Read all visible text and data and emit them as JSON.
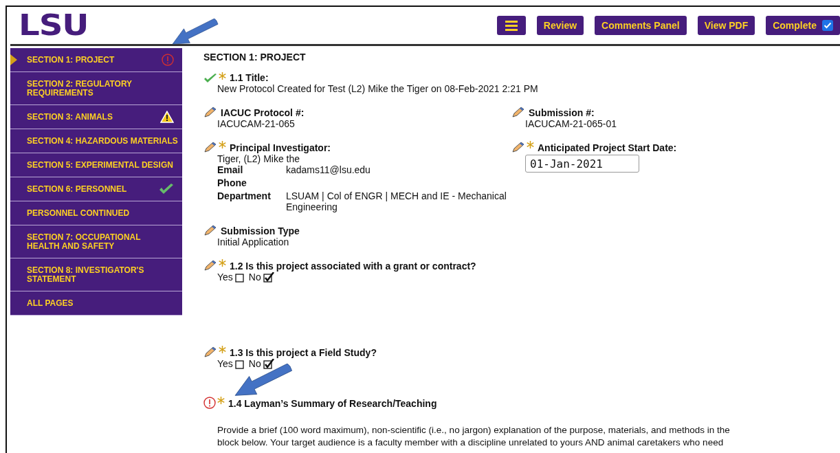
{
  "header": {
    "logo": "LSU",
    "menu_button": {
      "kind": "menu"
    },
    "buttons": [
      {
        "label": "Review",
        "kind": "plain"
      },
      {
        "label": "Comments Panel",
        "kind": "plain"
      },
      {
        "label": "View PDF",
        "kind": "plain"
      },
      {
        "label": "Complete",
        "kind": "checkbox",
        "checked": true
      }
    ]
  },
  "sidebar": {
    "items": [
      {
        "label": "SECTION 1: PROJECT",
        "selected": true,
        "kind": "error",
        "annotated": true
      },
      {
        "label": "SECTION 2: REGULATORY REQUIREMENTS",
        "selected": false,
        "kind": "plain",
        "annotated": false
      },
      {
        "label": "SECTION 3: ANIMALS",
        "selected": false,
        "kind": "warning",
        "annotated": false
      },
      {
        "label": "SECTION 4: HAZARDOUS MATERIALS",
        "selected": false,
        "kind": "plain",
        "annotated": false
      },
      {
        "label": "SECTION 5: EXPERIMENTAL DESIGN",
        "selected": false,
        "kind": "plain",
        "annotated": false
      },
      {
        "label": "SECTION 6: PERSONNEL",
        "selected": false,
        "kind": "done",
        "annotated": false
      },
      {
        "label": "PERSONNEL CONTINUED",
        "selected": false,
        "kind": "plain",
        "annotated": false
      },
      {
        "label": "SECTION 7: OCCUPATIONAL HEALTH AND SAFETY",
        "selected": false,
        "kind": "plain",
        "annotated": false
      },
      {
        "label": "SECTION 8: INVESTIGATOR'S STATEMENT",
        "selected": false,
        "kind": "plain",
        "annotated": false
      },
      {
        "label": "ALL PAGES",
        "selected": false,
        "kind": "plain",
        "annotated": false
      }
    ]
  },
  "content": {
    "heading": "SECTION 1: PROJECT",
    "rows": [
      {
        "kind": "single",
        "fields": [
          {
            "kind": "check",
            "required": true,
            "annotated": false,
            "label": "1.1 Title:",
            "value": "New Protocol Created for Test (L2) Mike the Tiger on 08-Feb-2021 2:21 PM"
          }
        ]
      },
      {
        "kind": "pair",
        "fields": [
          {
            "kind": "edit",
            "required": false,
            "annotated": false,
            "label": "IACUC Protocol #:",
            "value": "IACUCAM-21-065"
          },
          {
            "kind": "edit",
            "required": false,
            "annotated": false,
            "label": "Submission #:",
            "value": "IACUCAM-21-065-01"
          }
        ]
      },
      {
        "kind": "pair",
        "fields": [
          {
            "kind": "edit",
            "required": true,
            "annotated": false,
            "label": "Principal Investigator:",
            "value": "Tiger, (L2) Mike the",
            "details": [
              {
                "label": "Email",
                "value": "kadams11@lsu.edu"
              },
              {
                "label": "Phone"
              },
              {
                "label": "Department",
                "value": "LSUAM | Col of ENGR | MECH and IE - Mechanical Engineering"
              }
            ]
          },
          {
            "kind": "edit",
            "required": true,
            "annotated": false,
            "label": "Anticipated Project Start Date:",
            "input": "01-Jan-2021"
          }
        ]
      },
      {
        "kind": "single",
        "fields": [
          {
            "kind": "edit",
            "required": false,
            "annotated": false,
            "label": "Submission Type",
            "value": "Initial Application"
          }
        ]
      },
      {
        "kind": "single",
        "fields": [
          {
            "kind": "edit",
            "required": true,
            "annotated": false,
            "label": "1.2 Is this project associated with a grant or contract?",
            "options": [
              {
                "label": "Yes",
                "checked": false
              },
              {
                "label": "No",
                "checked": true
              }
            ]
          }
        ]
      },
      {
        "kind": "single",
        "fields": [
          {
            "kind": "edit",
            "required": true,
            "annotated": false,
            "label": "1.3 Is this project a Field Study?",
            "options": [
              {
                "label": "Yes",
                "checked": false
              },
              {
                "label": "No",
                "checked": true
              }
            ]
          }
        ]
      },
      {
        "kind": "single",
        "fields": [
          {
            "kind": "error",
            "required": true,
            "annotated": true,
            "label": "1.4 Layman’s Summary of Research/Teaching",
            "paragraph": [
              "Provide a brief (100 word maximum), non-scientific (i.e., no jargon) explanation of the purpose, materials, and methods in the",
              "block below. Your target audience is a faculty member with a discipline unrelated to yours AND animal caretakers who need"
            ]
          }
        ]
      }
    ]
  }
}
